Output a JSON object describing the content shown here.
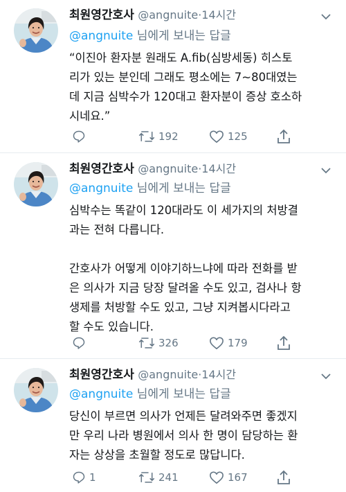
{
  "tweets": [
    {
      "name": "최원영간호사",
      "handle": "@angnuite",
      "dot": "·",
      "time": "14시간",
      "reply_to": "@angnuite",
      "reply_suffix": " 님에게 보내는 답글",
      "text": "“이진아 환자분 원래도 A.fib(심방세동) 히스토\n리가 있는 분인데 그래도 평소에는 7~80대였는\n데 지금 심박수가 120대고 환자분이 증상 호소하\n시네요.”",
      "replies": "",
      "retweets": "192",
      "likes": "125"
    },
    {
      "name": "최원영간호사",
      "handle": "@angnuite",
      "dot": "·",
      "time": "14시간",
      "reply_to": "@angnuite",
      "reply_suffix": " 님에게 보내는 답글",
      "text": "심박수는 똑같이 120대라도 이 세가지의 처방결\n과는 전혀 다릅니다.\n\n간호사가 어떻게 이야기하느냐에 따라 전화를 받\n은 의사가 지금 당장 달려올 수도 있고, 검사나 항\n생제를 처방할 수도 있고, 그냥 지켜봅시다라고\n할 수도 있습니다.",
      "replies": "",
      "retweets": "326",
      "likes": "179"
    },
    {
      "name": "최원영간호사",
      "handle": "@angnuite",
      "dot": "·",
      "time": "14시간",
      "reply_to": "@angnuite",
      "reply_suffix": " 님에게 보내는 답글",
      "text": "당신이 부르면 의사가 언제든 달려와주면 좋겠지\n만 우리 나라 병원에서 의사 한 명이 담당하는 환\n자는 상상을 초월할 정도로 많답니다.",
      "replies": "1",
      "retweets": "241",
      "likes": "167"
    }
  ],
  "icons": {
    "reply": "reply-icon",
    "retweet": "retweet-icon",
    "like": "heart-icon",
    "share": "share-icon",
    "menu": "chevron-down-icon"
  },
  "colors": {
    "text": "#14171a",
    "muted": "#657786",
    "link": "#1da1f2",
    "divider": "#e6ecf0"
  }
}
